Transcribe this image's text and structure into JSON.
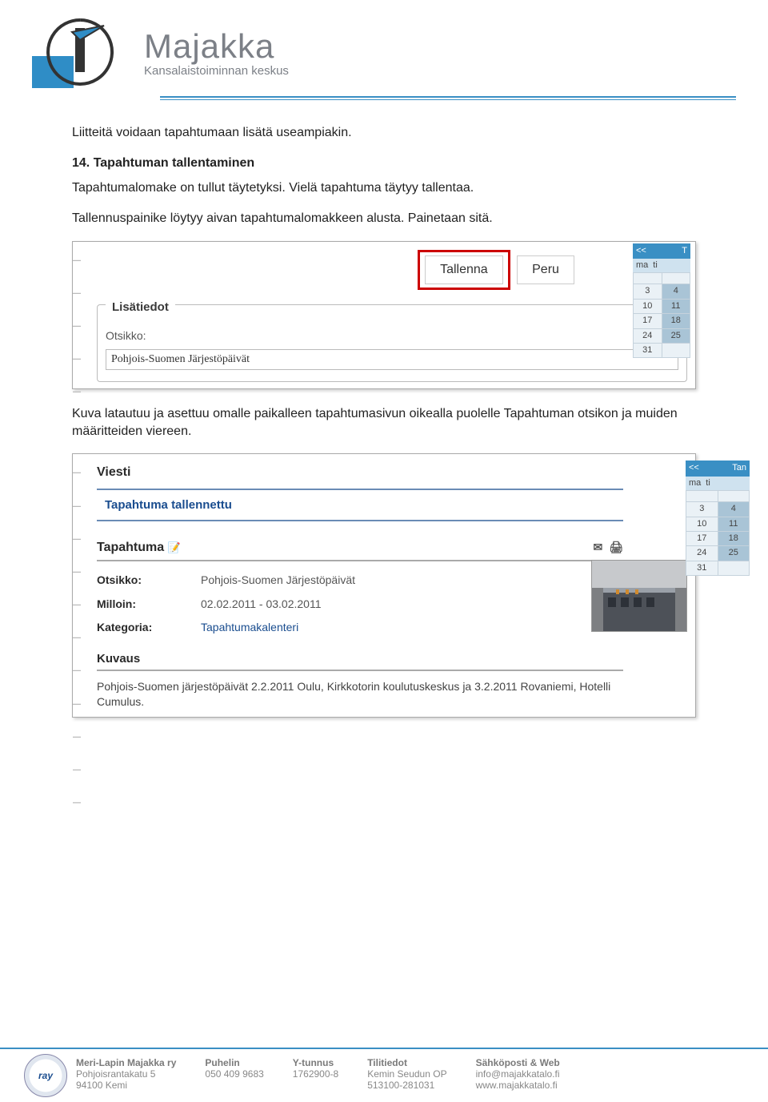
{
  "header": {
    "title": "Majakka",
    "subtitle": "Kansalaistoiminnan keskus"
  },
  "content": {
    "intro": "Liitteitä voidaan tapahtumaan lisätä useampiakin.",
    "step_title": "14. Tapahtuman tallentaminen",
    "step_p1": "Tapahtumalomake on tullut täytetyksi. Vielä tapahtuma täytyy tallentaa.",
    "step_p2": "Tallennuspainike löytyy aivan tapahtumalomakkeen alusta. Painetaan sitä.",
    "after_img": "Kuva latautuu ja asettuu omalle paikalleen tapahtumasivun oikealla puolelle Tapahtuman otsikon ja muiden määritteiden viereen."
  },
  "ss1": {
    "save_btn": "Tallenna",
    "cancel_btn": "Peru",
    "legend": "Lisätiedot",
    "title_label": "Otsikko:",
    "title_value": "Pohjois-Suomen Järjestöpäivät",
    "cal_nav": "<<",
    "cal_corner": "T",
    "cal_days": [
      "ma",
      "ti"
    ],
    "cal_rows": [
      [
        "",
        ""
      ],
      [
        "3",
        "4"
      ],
      [
        "10",
        "11"
      ],
      [
        "17",
        "18"
      ],
      [
        "24",
        "25"
      ],
      [
        "31",
        ""
      ]
    ]
  },
  "ss2": {
    "section_msg": "Viesti",
    "saved_msg": "Tapahtuma tallennettu",
    "section_event": "Tapahtuma",
    "fields": {
      "title_l": "Otsikko:",
      "title_v": "Pohjois-Suomen Järjestöpäivät",
      "when_l": "Milloin:",
      "when_v": "02.02.2011 - 03.02.2011",
      "cat_l": "Kategoria:",
      "cat_v": "Tapahtumakalenteri"
    },
    "desc_hdr": "Kuvaus",
    "desc_body": "Pohjois-Suomen järjestöpäivät 2.2.2011 Oulu, Kirkkotorin koulutuskeskus ja 3.2.2011 Rovaniemi, Hotelli Cumulus.",
    "cal_nav": "<<",
    "cal_corner": "Tan",
    "cal_days": [
      "ma",
      "ti"
    ],
    "cal_rows": [
      [
        "",
        ""
      ],
      [
        "3",
        "4"
      ],
      [
        "10",
        "11"
      ],
      [
        "17",
        "18"
      ],
      [
        "24",
        "25"
      ],
      [
        "31",
        ""
      ]
    ]
  },
  "footer": {
    "org_h": "Meri-Lapin Majakka ry",
    "org_l1": "Pohjoisrantakatu 5",
    "org_l2": "94100 Kemi",
    "tel_h": "Puhelin",
    "tel_v": "050 409 9683",
    "yt_h": "Y-tunnus",
    "yt_v": "1762900-8",
    "bank_h": "Tilitiedot",
    "bank_l1": "Kemin Seudun OP",
    "bank_l2": "513100-281031",
    "web_h": "Sähköposti & Web",
    "web_l1": "info@majakkatalo.fi",
    "web_l2": "www.majakkatalo.fi",
    "ray": "ray"
  }
}
